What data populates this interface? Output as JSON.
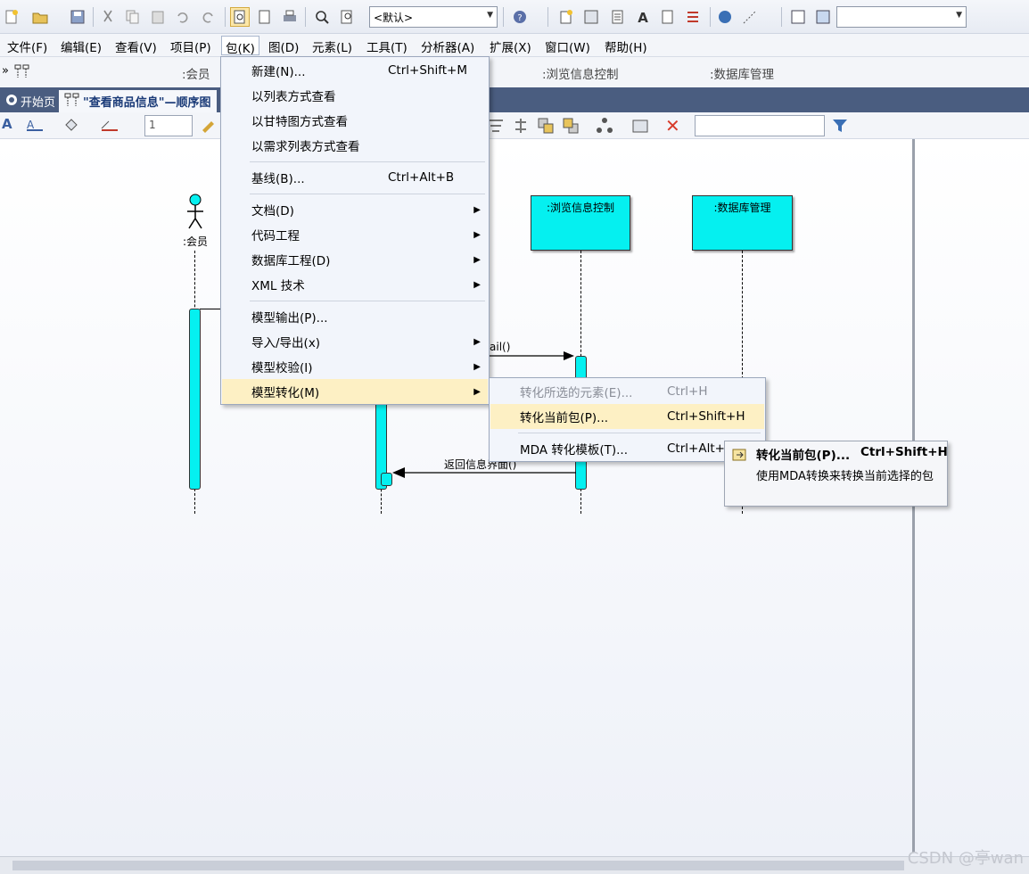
{
  "toolbar": {
    "style_select": "<默认>",
    "search_select": ""
  },
  "menubar": {
    "items": [
      "文件(F)",
      "编辑(E)",
      "查看(V)",
      "项目(P)",
      "包(K)",
      "图(D)",
      "元素(L)",
      "工具(T)",
      "分析器(A)",
      "扩展(X)",
      "窗口(W)",
      "帮助(H)"
    ]
  },
  "toolbar2": {
    "labels": [
      ":会员",
      ":浏览信息控制",
      ":数据库管理"
    ]
  },
  "tabs": [
    {
      "label": "开始页"
    },
    {
      "label": "\"查看商品信息\"—顺序图"
    }
  ],
  "toolbar3": {
    "font_size": "1",
    "find_input": ""
  },
  "diagram": {
    "actor": ":会员",
    "lifelines": [
      ":浏览信息控制",
      ":数据库管理"
    ],
    "messages": [
      "ail()",
      "返回信息界面()"
    ],
    "colors": {
      "lifeline_fill": "#05f0f0"
    }
  },
  "package_menu": {
    "items": [
      {
        "label": "新建(N)...",
        "shortcut": "Ctrl+Shift+M"
      },
      {
        "label": "以列表方式查看",
        "shortcut": ""
      },
      {
        "label": "以甘特图方式查看",
        "shortcut": ""
      },
      {
        "label": "以需求列表方式查看",
        "shortcut": ""
      },
      {
        "label": "基线(B)...",
        "shortcut": "Ctrl+Alt+B"
      },
      {
        "label": "文档(D)",
        "shortcut": ""
      },
      {
        "label": "代码工程",
        "shortcut": ""
      },
      {
        "label": "数据库工程(D)",
        "shortcut": ""
      },
      {
        "label": "XML 技术",
        "shortcut": ""
      },
      {
        "label": "模型输出(P)...",
        "shortcut": ""
      },
      {
        "label": "导入/导出(x)",
        "shortcut": ""
      },
      {
        "label": "模型校验(I)",
        "shortcut": ""
      },
      {
        "label": "模型转化(M)",
        "shortcut": ""
      }
    ]
  },
  "transform_submenu": {
    "items": [
      {
        "label": "转化所选的元素(E)...",
        "shortcut": "Ctrl+H"
      },
      {
        "label": "转化当前包(P)...",
        "shortcut": "Ctrl+Shift+H"
      },
      {
        "label": "MDA 转化模板(T)...",
        "shortcut": "Ctrl+Alt+H"
      }
    ]
  },
  "tooltip": {
    "title": "转化当前包(P)...",
    "shortcut": "Ctrl+Shift+H",
    "description": "使用MDA转换来转换当前选择的包"
  },
  "watermark": "CSDN @亭wan"
}
